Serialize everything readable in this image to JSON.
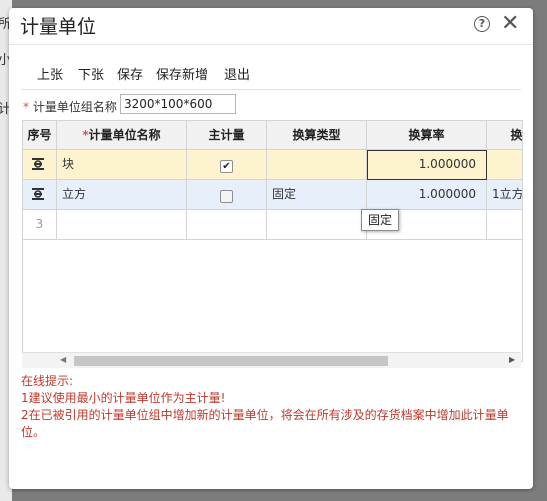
{
  "background": {
    "chars": [
      "所",
      "小",
      "计"
    ]
  },
  "dialog": {
    "title": "计量单位",
    "help_icon": "question-circle-icon",
    "close_icon": "close-icon",
    "close_label": "✕",
    "help_label": "?"
  },
  "toolbar": {
    "prev": "上张",
    "next": "下张",
    "save": "保存",
    "save_new": "保存新增",
    "exit": "退出"
  },
  "form": {
    "group_name_label": "计量单位组名称",
    "required_mark": "*",
    "group_name_value": "3200*100*600"
  },
  "grid": {
    "columns": [
      "序号",
      "计量单位名称",
      "主计量",
      "换算类型",
      "换算率",
      "换"
    ],
    "rows": [
      {
        "unit_name": "块",
        "primary": true,
        "conversion_type": "",
        "rate": "1.000000",
        "extra": ""
      },
      {
        "unit_name": "立方",
        "primary": false,
        "conversion_type": "固定",
        "rate": "1.000000",
        "extra": "1立方"
      },
      {
        "row_number": "3",
        "unit_name": "",
        "conversion_type": "",
        "rate": "",
        "extra": ""
      }
    ],
    "tooltip": "固定",
    "check_mark": "✔"
  },
  "scrollbar": {
    "left_arrow": "◀",
    "right_arrow": "▶"
  },
  "tips": {
    "heading": "在线提示:",
    "line1": "1建议使用最小的计量单位作为主计量!",
    "line2": "2在已被引用的计量单位组中增加新的计量单位，将会在所有涉及的存货档案中增加此计量单位。"
  }
}
